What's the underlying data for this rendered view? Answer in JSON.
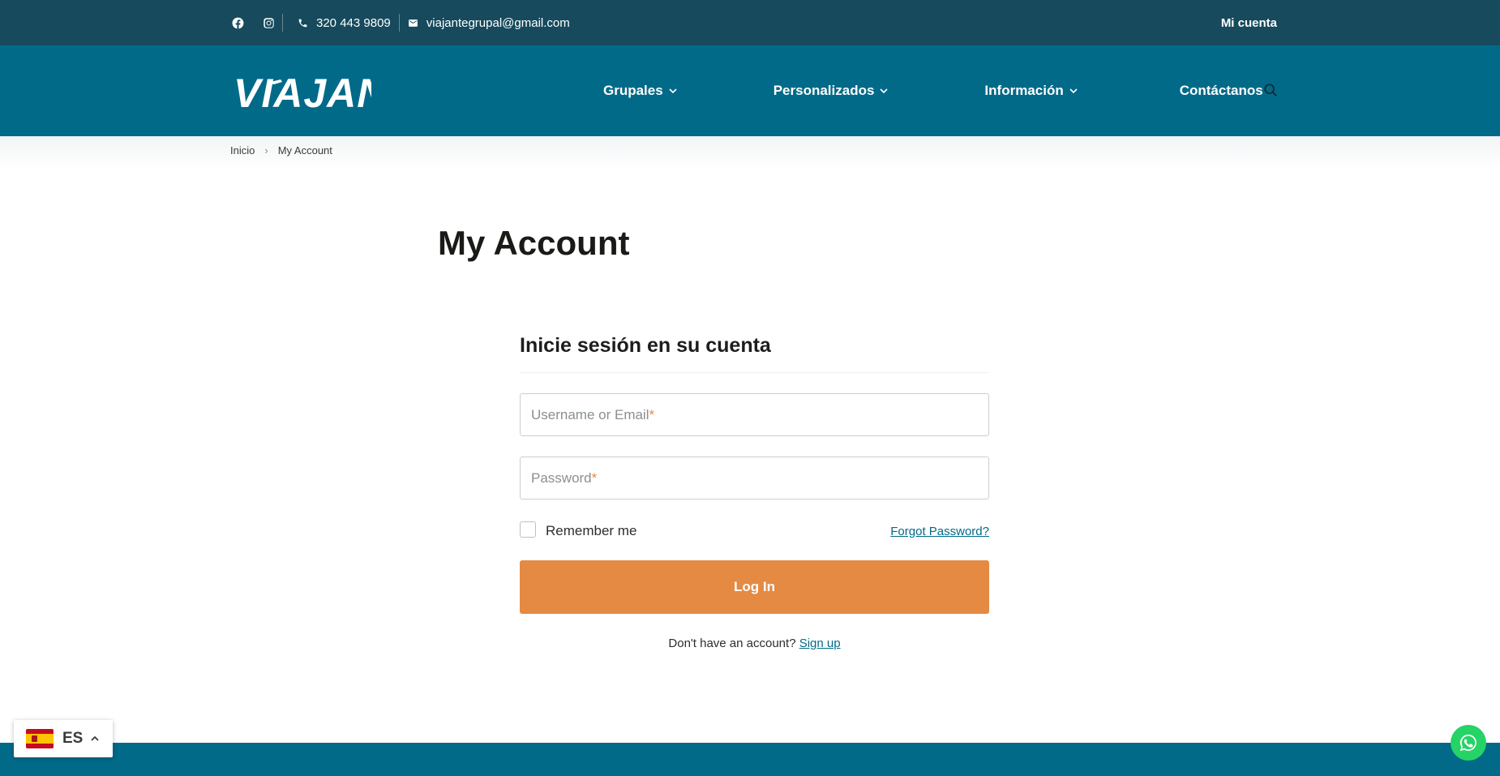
{
  "topbar": {
    "phone": "320 443 9809",
    "email": "viajantegrupal@gmail.com",
    "account_link": "Mi cuenta",
    "social": [
      "facebook-icon",
      "instagram-icon"
    ]
  },
  "logo": {
    "text": "VIAJANTE"
  },
  "nav": {
    "items": [
      {
        "label": "Grupales",
        "has_dropdown": true
      },
      {
        "label": "Personalizados",
        "has_dropdown": true
      },
      {
        "label": "Información",
        "has_dropdown": true
      },
      {
        "label": "Contáctanos",
        "has_dropdown": false
      }
    ]
  },
  "breadcrumb": {
    "home": "Inicio",
    "current": "My Account"
  },
  "page": {
    "title": "My Account"
  },
  "login": {
    "heading": "Inicie sesión en su cuenta",
    "username_placeholder": "Username or Email",
    "password_placeholder": "Password",
    "required_mark": "*",
    "remember_label": "Remember me",
    "forgot_link": "Forgot Password?",
    "submit_label": "Log In",
    "signup_prompt": "Don't have an account?",
    "signup_link": "Sign up"
  },
  "language": {
    "code": "ES",
    "flag": "spain-flag-icon"
  },
  "colors": {
    "topbar": "#164a5c",
    "nav": "#016a89",
    "accent": "#e48a43",
    "whatsapp": "#25d366"
  }
}
